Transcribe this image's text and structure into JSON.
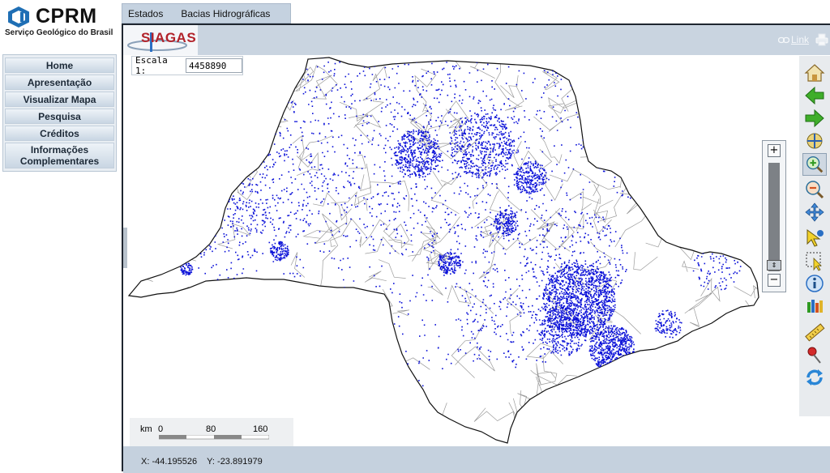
{
  "brand": {
    "name": "CPRM",
    "subtitle": "Serviço Geológico do Brasil",
    "app_logo": "SIAGAS",
    "logo_color": "#1f6fb5"
  },
  "menu": {
    "items": [
      {
        "label": "Home"
      },
      {
        "label": "Apresentação"
      },
      {
        "label": "Visualizar Mapa"
      },
      {
        "label": "Pesquisa"
      },
      {
        "label": "Créditos"
      },
      {
        "label": "Informações Complementares"
      }
    ]
  },
  "tabs": [
    {
      "label": "Estados"
    },
    {
      "label": "Bacias Hidrográficas"
    }
  ],
  "header": {
    "link_label": "Link"
  },
  "scale": {
    "label": "Escala 1:",
    "value": "4458890"
  },
  "scalebar": {
    "unit": "km",
    "ticks": [
      "0",
      "80",
      "160"
    ]
  },
  "status": {
    "x_label": "X:",
    "x_value": "-44.195526",
    "y_label": "Y:",
    "y_value": "-23.891979"
  },
  "toolbar": {
    "tools": [
      {
        "name": "home-icon"
      },
      {
        "name": "back-arrow-icon"
      },
      {
        "name": "forward-arrow-icon"
      },
      {
        "name": "full-extent-icon"
      },
      {
        "name": "zoom-in-icon"
      },
      {
        "name": "zoom-out-icon"
      },
      {
        "name": "pan-icon"
      },
      {
        "name": "identify-pointer-icon"
      },
      {
        "name": "select-box-icon"
      },
      {
        "name": "info-icon"
      },
      {
        "name": "layers-icon"
      },
      {
        "name": "measure-ruler-icon"
      },
      {
        "name": "pushpin-icon"
      },
      {
        "name": "refresh-icon"
      }
    ]
  },
  "map": {
    "point_color": "#0a10d8",
    "border_color": "#9a9a9a"
  }
}
